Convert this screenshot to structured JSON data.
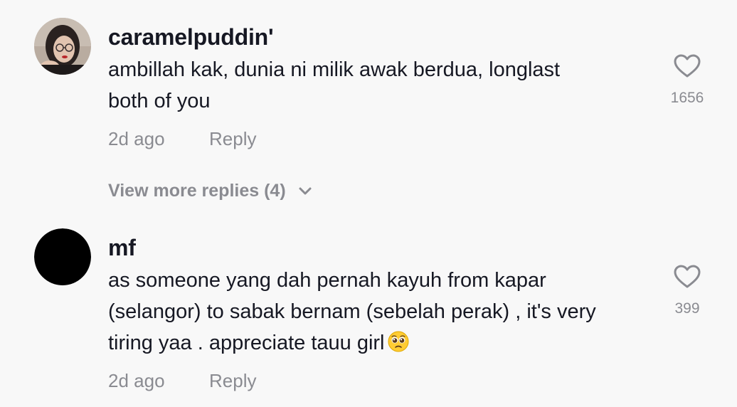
{
  "comments": [
    {
      "username": "caramelpuddin'",
      "text": "ambillah kak, dunia ni milik awak berdua, longlast\nboth of you",
      "time": "2d ago",
      "reply_label": "Reply",
      "like_count": "1656",
      "avatar": "photo"
    },
    {
      "username": "mf",
      "text": "as someone yang dah pernah kayuh from kapar\n(selangor) to sabak bernam (sebelah perak) , it's very\ntiring yaa . appreciate tauu girl",
      "emoji": "pleading-face-emoji",
      "time": "2d ago",
      "reply_label": "Reply",
      "like_count": "399",
      "avatar": "black-circle"
    }
  ],
  "view_more_replies": "View more replies (4)",
  "icons": {
    "like": "heart-outline-icon",
    "expand": "chevron-down-icon"
  },
  "colors": {
    "background": "#f8f8f8",
    "text": "#161823",
    "secondary": "#8a8b91"
  }
}
